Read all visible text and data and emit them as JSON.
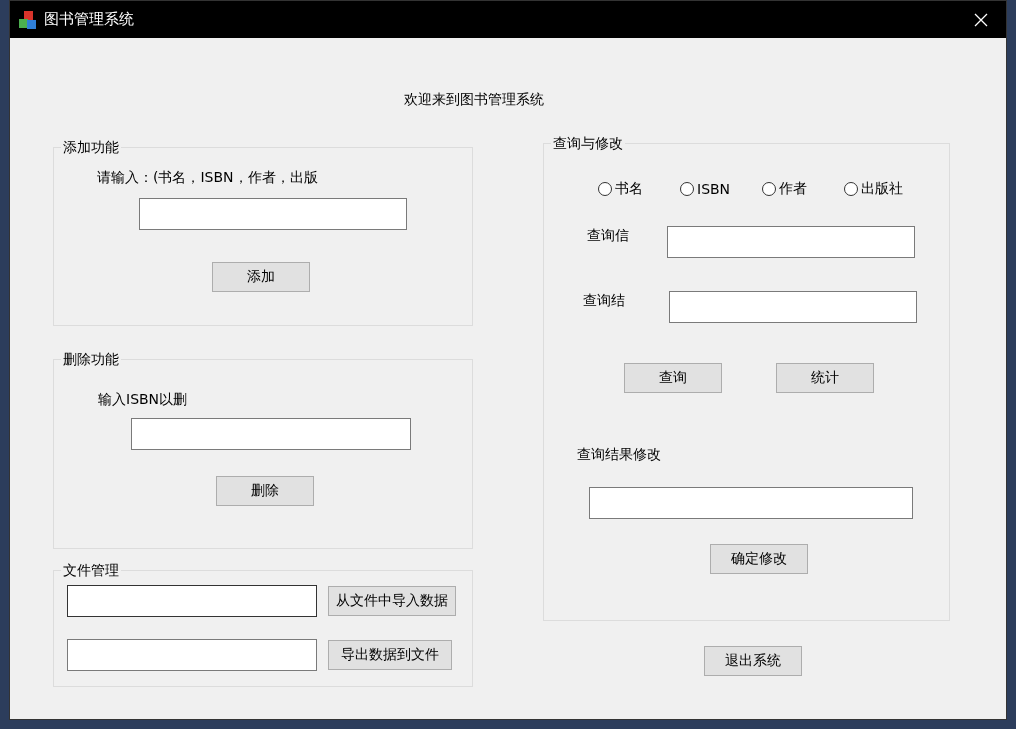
{
  "window": {
    "title": "图书管理系统"
  },
  "welcome": "欢迎来到图书管理系统",
  "add_group": {
    "title": "添加功能",
    "prompt": "请输入：(书名，ISBN，作者，出版",
    "button": "添加"
  },
  "delete_group": {
    "title": "删除功能",
    "prompt": "输入ISBN以删",
    "button": "删除"
  },
  "file_group": {
    "title": "文件管理",
    "rows": [
      {
        "button": "从文件中导入数据",
        "focused": true
      },
      {
        "button": "导出数据到文件",
        "focused": false
      }
    ]
  },
  "query_group": {
    "title": "查询与修改",
    "radios": [
      {
        "label": "书名",
        "selected": false
      },
      {
        "label": "ISBN",
        "selected": false
      },
      {
        "label": "作者",
        "selected": false
      },
      {
        "label": "出版社",
        "selected": false
      }
    ],
    "fields": [
      {
        "label": "查询信"
      },
      {
        "label": "查询结"
      }
    ],
    "buttons": [
      "查询",
      "统计"
    ],
    "edit_label": "查询结果修改",
    "confirm_button": "确定修改"
  },
  "exit_button": "退出系统"
}
